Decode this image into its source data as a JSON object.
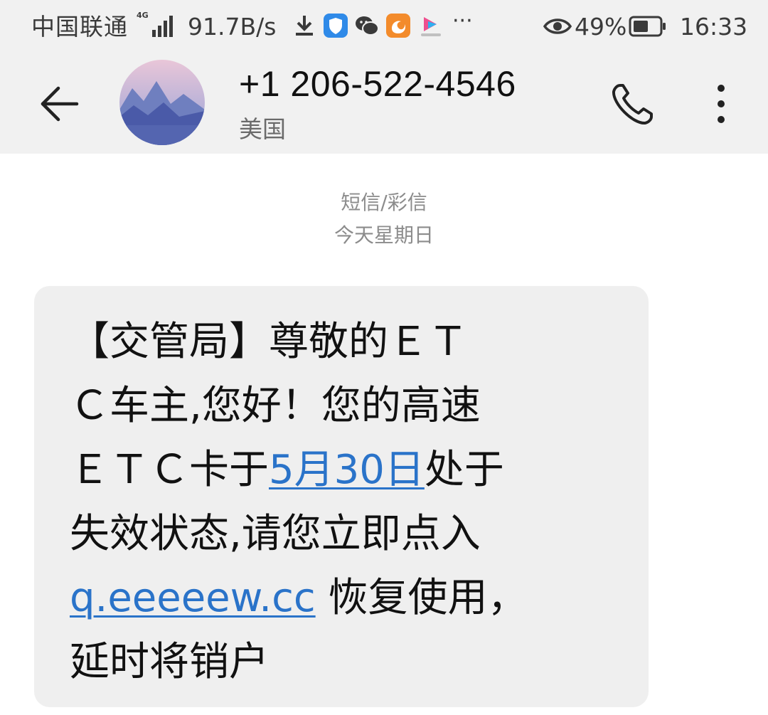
{
  "status_bar": {
    "carrier": "中国联通",
    "network_type": "4G",
    "net_speed": "91.7B/s",
    "more_notifications": "···",
    "battery_percent": "49%",
    "time": "16:33",
    "icons": [
      "download-icon",
      "shield-app-icon",
      "wechat-icon",
      "uc-browser-icon",
      "youku-icon",
      "eye-icon",
      "battery-icon",
      "signal-icon"
    ]
  },
  "header": {
    "contact_number": "+1 206-522-4546",
    "contact_region": "美国",
    "icons": [
      "back-arrow-icon",
      "avatar",
      "phone-icon",
      "more-vert-icon"
    ]
  },
  "conversation": {
    "channel": "短信/彩信",
    "date": "今天星期日",
    "message": {
      "line1": "【交管局】尊敬的ＥＴ",
      "line2": "Ｃ车主,您好！您的高速",
      "line3_pre": "ＥＴＣ卡于",
      "line3_link": "5月30日",
      "line3_post": "处于",
      "line4": "失效状态,请您立即点入",
      "line5_link": "q.eeeeew.cc",
      "line5_post": " 恢复使用，",
      "line6": "延时将销户"
    }
  },
  "colors": {
    "bar_background": "#f1f1f1",
    "bubble_background": "#efefef",
    "link": "#2a73c9",
    "secondary_text": "#8c8c8c"
  }
}
